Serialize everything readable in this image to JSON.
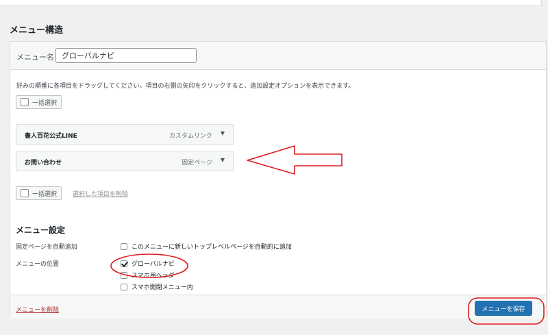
{
  "section_title": "メニュー構造",
  "menu_name": {
    "label": "メニュー名",
    "value": "グローバルナビ"
  },
  "instructions": "好みの順番に各項目をドラッグしてください。項目の右側の矢印をクリックすると、追加設定オプションを表示できます。",
  "bulk_select_label": "一括選択",
  "delete_selected_label": "選択した項目を削除",
  "menu_items": [
    {
      "title": "書人百花公式LINE",
      "type": "カスタムリンク"
    },
    {
      "title": "お問い合わせ",
      "type": "固定ページ"
    }
  ],
  "settings": {
    "title": "メニュー設定",
    "auto_add": {
      "label": "固定ページを自動追加",
      "option": "このメニューに新しいトップレベルページを自動的に追加"
    },
    "location": {
      "label": "メニューの位置",
      "options": [
        {
          "label": "グローバルナビ",
          "checked": true
        },
        {
          "label": "スマホ用ヘッダ",
          "checked": false
        },
        {
          "label": "スマホ開閉メニュー内",
          "checked": false
        }
      ]
    }
  },
  "footer": {
    "delete_menu": "メニューを削除",
    "save": "メニューを保存"
  },
  "colors": {
    "primary": "#2271b1",
    "annotation": "#e0191e",
    "delete": "#b32d2e"
  }
}
